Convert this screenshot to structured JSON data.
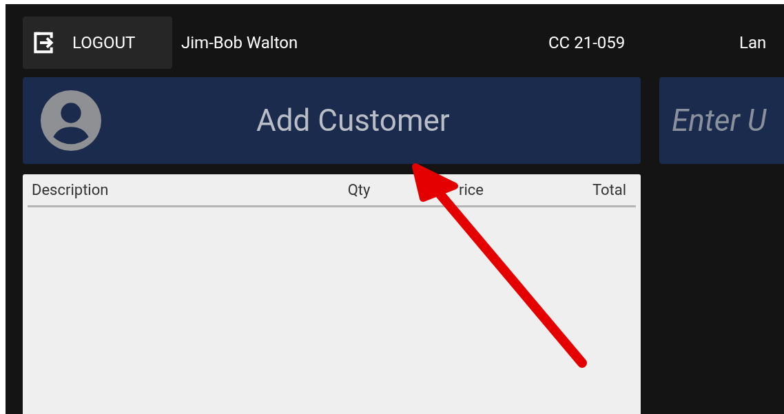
{
  "top_bar": {
    "logout": "LOGOUT",
    "user": "Jim-Bob Walton",
    "register": "CC 21-059",
    "lane": "Lan"
  },
  "customer_button": {
    "label": "Add Customer"
  },
  "upc_field": {
    "placeholder": "Enter U"
  },
  "table": {
    "columns": [
      "Description",
      "Qty",
      "rice",
      "Total"
    ]
  }
}
